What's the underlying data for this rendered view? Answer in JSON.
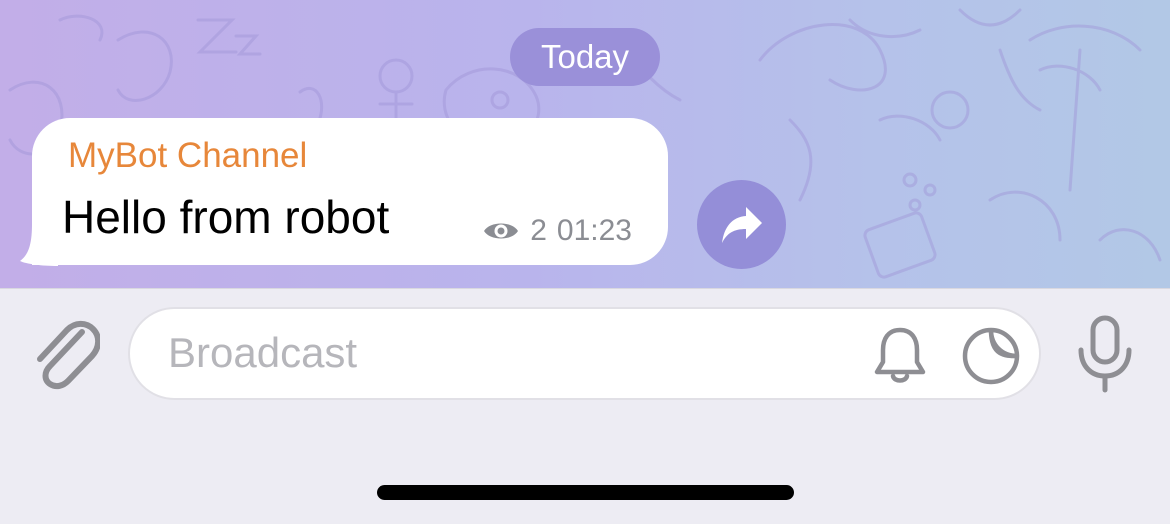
{
  "chat": {
    "date_label": "Today",
    "message": {
      "sender": "MyBot Channel",
      "text": "Hello from robot",
      "views": "2",
      "time": "01:23"
    }
  },
  "composer": {
    "placeholder": "Broadcast"
  },
  "icons": {
    "attach": "paperclip-icon",
    "share": "share-arrow-icon",
    "views": "eye-icon",
    "silent": "bell-icon",
    "sticker": "sticker-icon",
    "voice": "microphone-icon"
  },
  "colors": {
    "sender": "#e7873a",
    "accent": "#948ed8",
    "date_pill": "#9a90d9"
  }
}
